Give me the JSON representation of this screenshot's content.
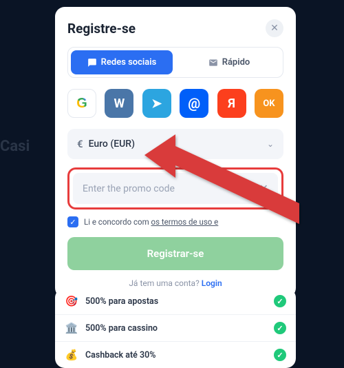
{
  "bg": {
    "casino": "Casi"
  },
  "modal": {
    "title": "Registre-se",
    "tabs": {
      "social": "Redes sociais",
      "quick": "Rápido"
    },
    "currency": {
      "symbol": "€",
      "label": "Euro (EUR)"
    },
    "promo": {
      "placeholder": "Enter the promo code"
    },
    "terms": {
      "prefix": "Li e concordo com ",
      "link": "os termos de uso e"
    },
    "registerBtn": "Registrar-se",
    "loginPrompt": "Já tem uma conta? ",
    "loginLink": "Login"
  },
  "social": {
    "google": "G",
    "vk": "W",
    "telegram": "➤",
    "mail": "@",
    "yandex": "Я",
    "ok": "OK"
  },
  "bonuses": [
    {
      "icon": "🎯",
      "text": "500% para apostas"
    },
    {
      "icon": "🏛️",
      "text": "500% para cassino"
    },
    {
      "icon": "💰",
      "text": "Cashback até 30%"
    }
  ]
}
